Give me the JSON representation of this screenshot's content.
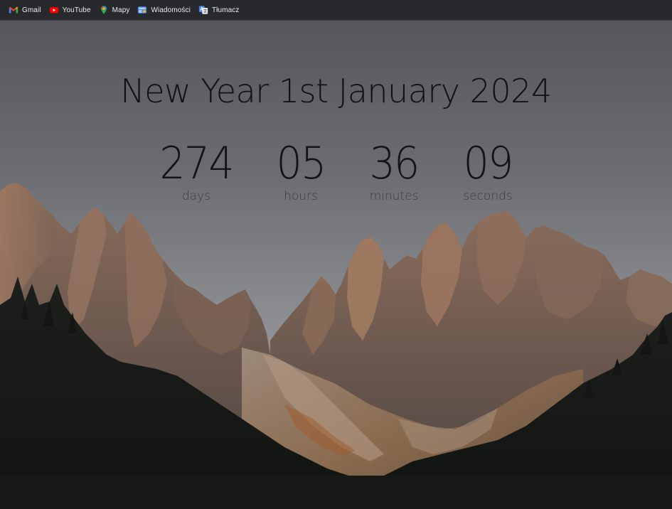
{
  "bookmarks": [
    {
      "label": "Gmail",
      "icon": "gmail-icon"
    },
    {
      "label": "YouTube",
      "icon": "youtube-icon"
    },
    {
      "label": "Mapy",
      "icon": "maps-icon"
    },
    {
      "label": "Wiadomości",
      "icon": "news-icon"
    },
    {
      "label": "Tłumacz",
      "icon": "translate-icon"
    }
  ],
  "headline": "New Year 1st January 2024",
  "countdown": {
    "days": {
      "value": "274",
      "label": "days"
    },
    "hours": {
      "value": "05",
      "label": "hours"
    },
    "minutes": {
      "value": "36",
      "label": "minutes"
    },
    "seconds": {
      "value": "09",
      "label": "seconds"
    }
  },
  "colors": {
    "bookmarks_bar": "#28292c",
    "text_dark": "#131416",
    "label_gray": "#3b3d41"
  }
}
